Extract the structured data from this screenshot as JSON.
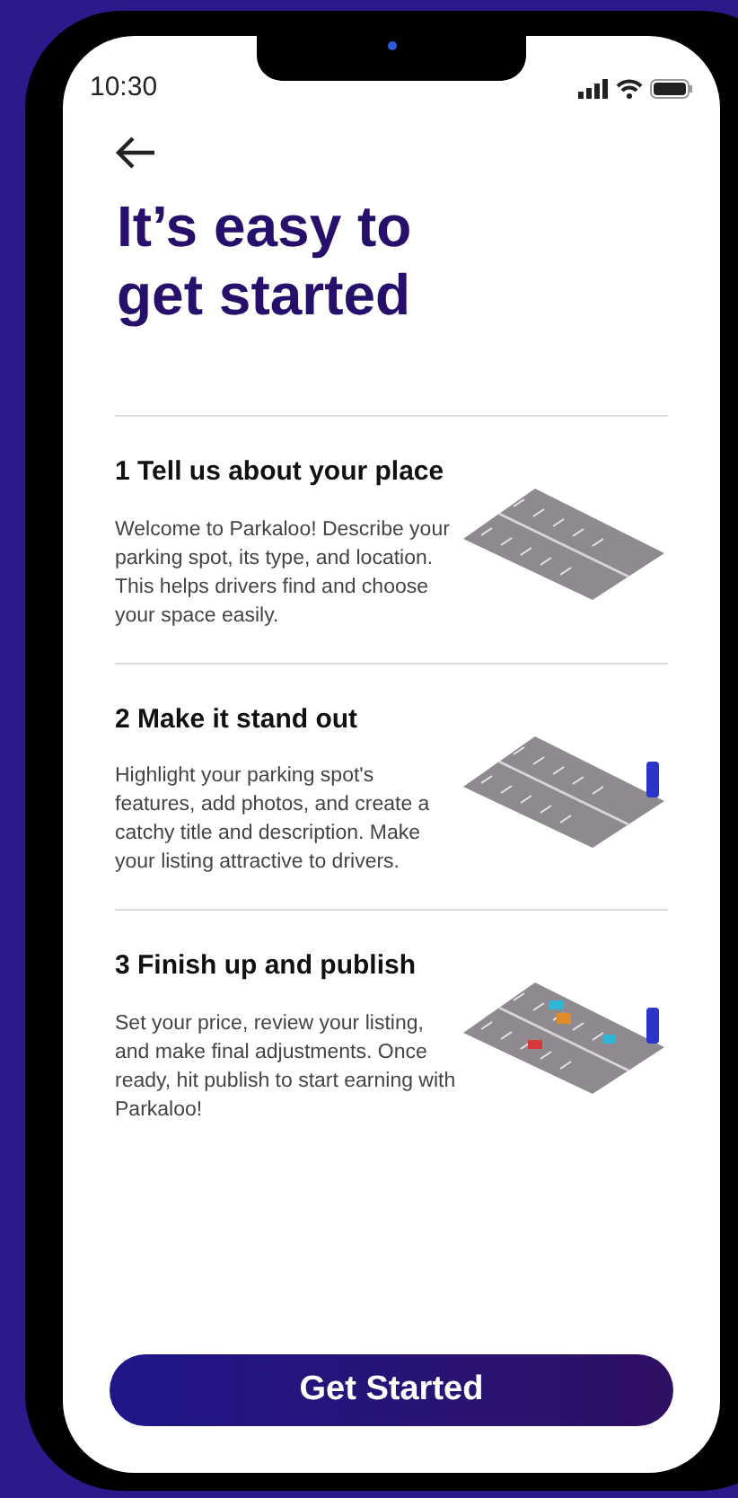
{
  "status_bar": {
    "time": "10:30"
  },
  "title": "It’s easy to get started",
  "steps": [
    {
      "title": "1 Tell us about your place",
      "description": "Welcome to Parkaloo! Describe your parking spot, its type, and location. This helps drivers find and choose your space easily."
    },
    {
      "title": "2 Make it stand out",
      "description": "Highlight your parking spot's features, add photos, and create a catchy title and description. Make your listing attractive to drivers."
    },
    {
      "title": "3 Finish up and publish",
      "description": "Set your price, review your listing, and make final adjustments. Once ready, hit publish to start earning with Parkaloo!"
    }
  ],
  "button": {
    "label": "Get Started"
  }
}
